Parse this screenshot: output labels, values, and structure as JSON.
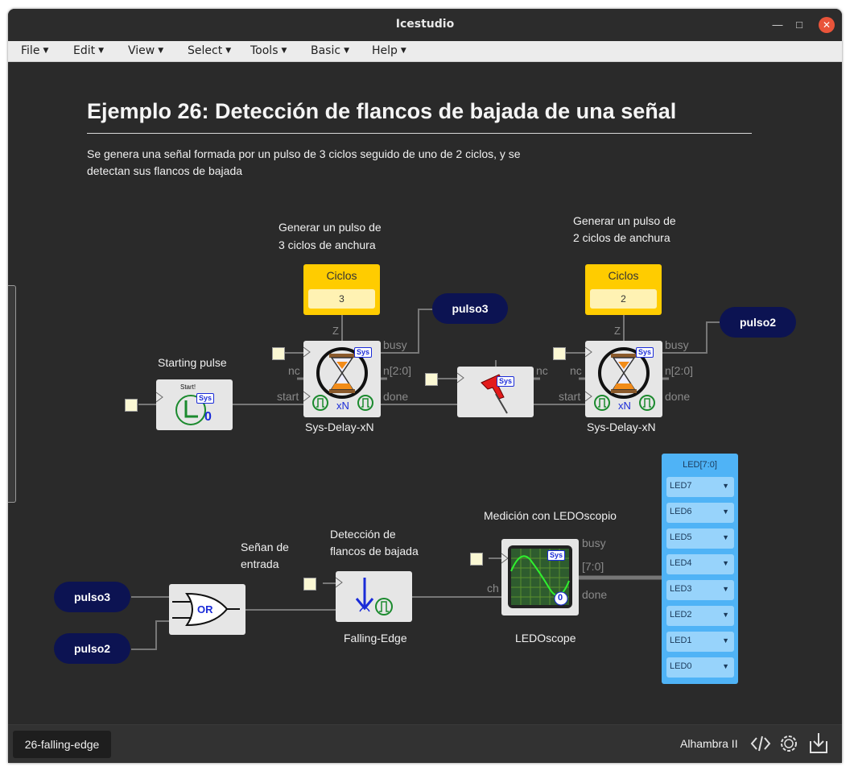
{
  "window": {
    "title": "Icestudio"
  },
  "menu": [
    "File",
    "Edit",
    "View",
    "Select",
    "Tools",
    "Basic",
    "Help"
  ],
  "heading": "Ejemplo 26: Detección de flancos de bajada de una señal",
  "description_line1": "Se genera una señal formada por un pulso de 3 ciclos seguido de uno de 2 ciclos, y se",
  "description_line2": "detectan sus flancos de bajada",
  "comments": {
    "gen3_line1": "Generar un pulso de",
    "gen3_line2": "3 ciclos de anchura",
    "gen2_line1": "Generar un pulso de",
    "gen2_line2": "2 ciclos de anchura",
    "starting": "Starting pulse",
    "senal_line1": "Señan de",
    "senal_line2": "entrada",
    "detect_line1": "Detección de",
    "detect_line2": "flancos de bajada",
    "medicion": "Medición con LEDOscopio"
  },
  "constants": {
    "ciclos3": {
      "label": "Ciclos",
      "value": "3"
    },
    "ciclos2": {
      "label": "Ciclos",
      "value": "2"
    }
  },
  "pills": {
    "pulso3_top": "pulso3",
    "pulso2_top": "pulso2",
    "pulso3_in": "pulso3",
    "pulso2_in": "pulso2"
  },
  "ports": {
    "busy": "busy",
    "nc": "nc",
    "n": "n[2:0]",
    "start": "start",
    "done": "done",
    "z": "Z",
    "ch": "ch",
    "bus": "[7:0]"
  },
  "blocks": {
    "sysdelay": "Sys-Delay-xN",
    "falling": "Falling-Edge",
    "ledoscope": "LEDOscope",
    "sys": "Sys",
    "start_text": "Start!",
    "zero": "0",
    "xn": "xN",
    "or": "OR"
  },
  "leds": {
    "title": "LED[7:0]",
    "items": [
      "LED7",
      "LED6",
      "LED5",
      "LED4",
      "LED3",
      "LED2",
      "LED1",
      "LED0"
    ]
  },
  "status": {
    "tab": "26-falling-edge",
    "board": "Alhambra II"
  },
  "icons": [
    "verilog-code-icon",
    "board-settings-icon",
    "download-icon"
  ]
}
